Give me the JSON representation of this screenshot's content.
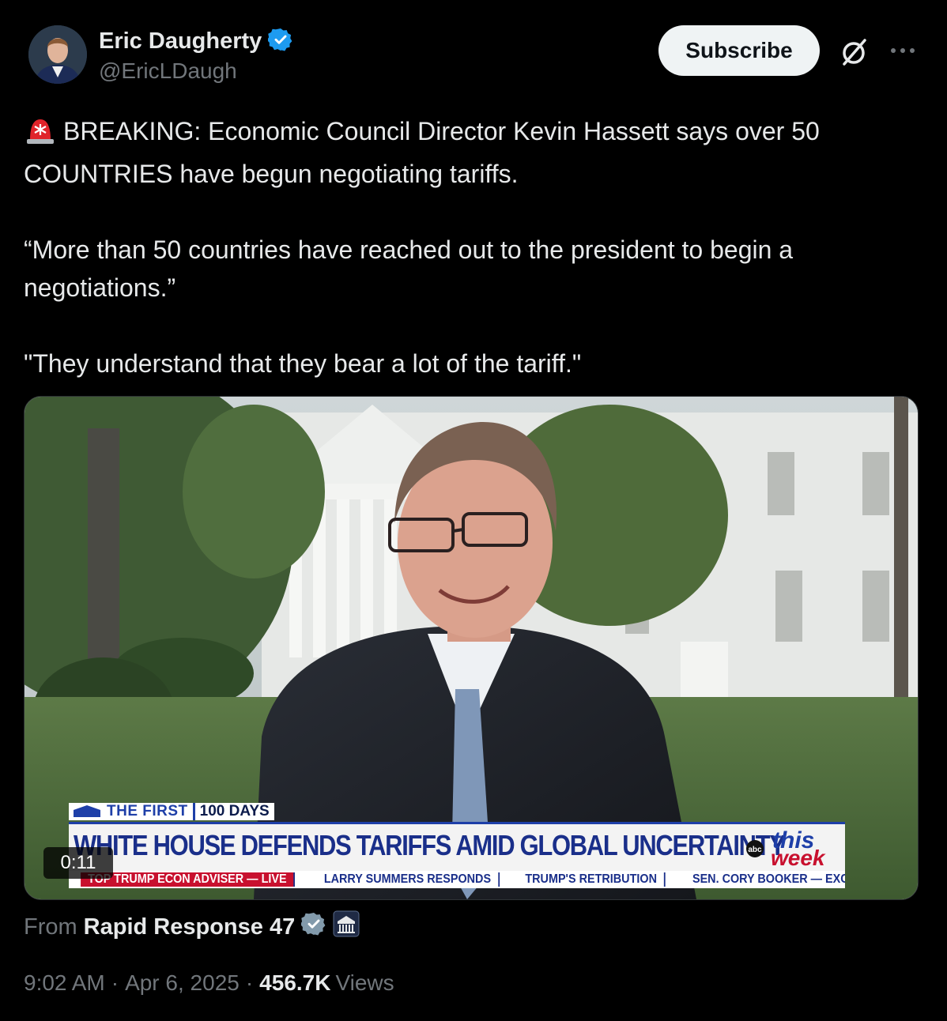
{
  "author": {
    "name": "Eric Daugherty",
    "handle": "@EricLDaugh",
    "verified": true
  },
  "header": {
    "subscribe_label": "Subscribe",
    "grok_icon": "grok-icon",
    "more_icon": "more-icon"
  },
  "tweet": {
    "line1": "BREAKING: Economic Council Director Kevin Hassett says over 50 COUNTRIES have begun negotiating tariffs.",
    "line2": "“More than 50 countries have reached out to the president to begin a negotiations.”",
    "line3": "\"They understand that they bear a lot of the tariff.\""
  },
  "video": {
    "duration": "0:11",
    "lower_third": {
      "tag_first": "THE FIRST",
      "tag_days": "100 DAYS",
      "headline": "WHITE HOUSE DEFENDS TARIFFS AMID GLOBAL UNCERTAINTY",
      "ticker": [
        "TOP TRUMP ECON ADVISER — LIVE",
        "LARRY SUMMERS RESPONDS",
        "TRUMP'S RETRIBUTION",
        "SEN. CORY BOOKER — EXCLUSIVE"
      ],
      "logo_small": "abc",
      "logo_this": "this",
      "logo_week": "week"
    }
  },
  "source": {
    "from_label": "From",
    "name": "Rapid Response 47"
  },
  "meta": {
    "time": "9:02 AM",
    "date": "Apr 6, 2025",
    "views_count": "456.7K",
    "views_label": "Views"
  },
  "colors": {
    "verified": "#1d9bf0",
    "gray": "#71767b",
    "text": "#e7e9ea"
  }
}
